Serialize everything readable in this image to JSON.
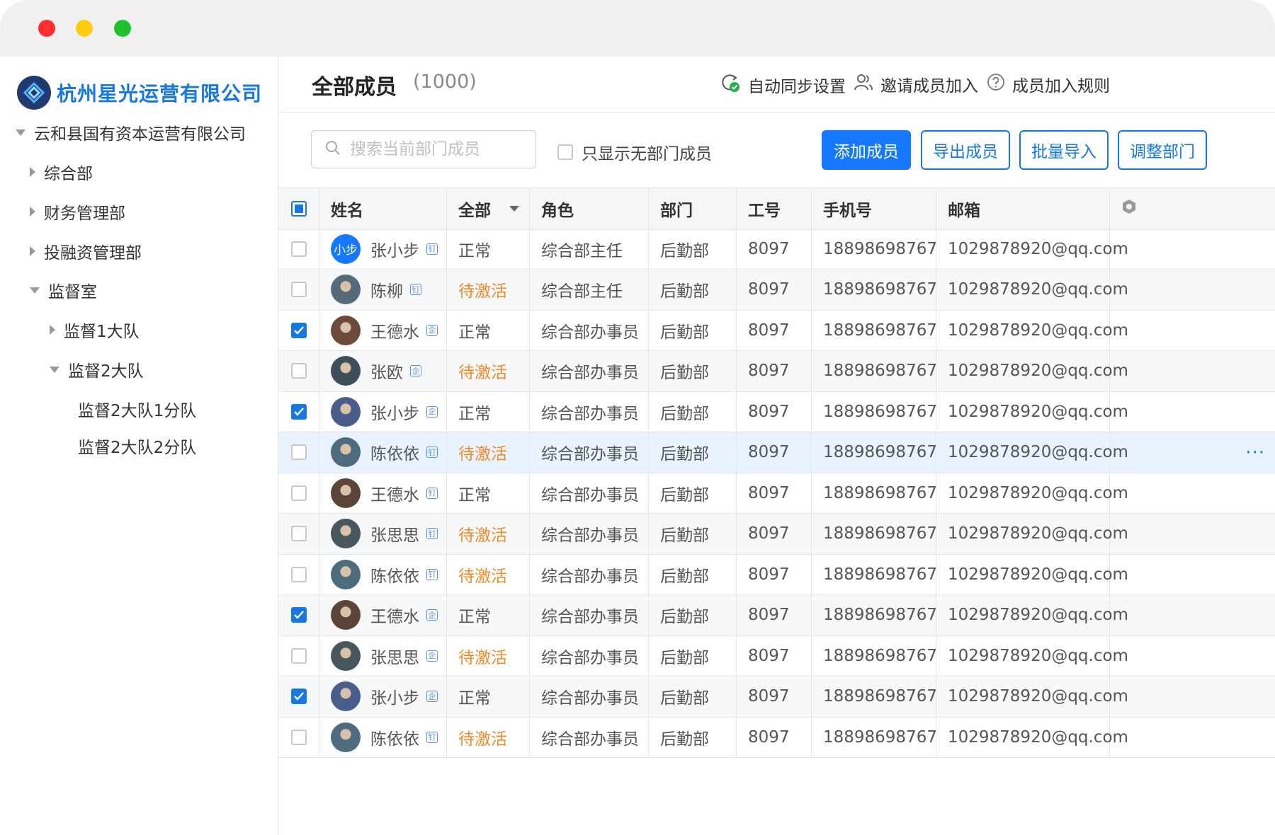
{
  "window": {
    "controls": [
      "close",
      "minimize",
      "maximize"
    ]
  },
  "sidebar": {
    "company": "杭州星光运营有限公司",
    "tree": [
      {
        "label": "云和县国有资本运营有限公司",
        "expanded": true,
        "level": 0
      },
      {
        "label": "综合部",
        "expanded": false,
        "level": 1
      },
      {
        "label": "财务管理部",
        "expanded": false,
        "level": 1
      },
      {
        "label": "投融资管理部",
        "expanded": false,
        "level": 1
      },
      {
        "label": "监督室",
        "expanded": true,
        "level": 1
      },
      {
        "label": "监督1大队",
        "expanded": false,
        "level": 2
      },
      {
        "label": "监督2大队",
        "expanded": true,
        "level": 2
      },
      {
        "label": "监督2大队1分队",
        "level": 3
      },
      {
        "label": "监督2大队2分队",
        "level": 3
      }
    ]
  },
  "header": {
    "title": "全部成员",
    "count": "(1000)",
    "actions": {
      "sync": "自动同步设置",
      "invite": "邀请成员加入",
      "rules": "成员加入规则"
    }
  },
  "toolbar": {
    "search_placeholder": "搜索当前部门成员",
    "only_no_dept": "只显示无部门成员",
    "add": "添加成员",
    "export": "导出成员",
    "import": "批量导入",
    "adjust": "调整部门"
  },
  "table": {
    "columns": {
      "name": "姓名",
      "status": "全部",
      "role": "角色",
      "dept": "部门",
      "id": "工号",
      "phone": "手机号",
      "email": "邮箱"
    },
    "rows": [
      {
        "name": "张小步",
        "avatar": "小步",
        "tag": "钉",
        "status": "正常",
        "role": "综合部主任",
        "dept": "后勤部",
        "id": "8097",
        "phone": "18898698767",
        "email": "1029878920@qq.com",
        "checked": false
      },
      {
        "name": "陈柳",
        "tag": "钉",
        "status": "待激活",
        "role": "综合部主任",
        "dept": "后勤部",
        "id": "8097",
        "phone": "18898698767",
        "email": "1029878920@qq.com",
        "checked": false
      },
      {
        "name": "王德水",
        "tag": "企",
        "status": "正常",
        "role": "综合部办事员",
        "dept": "后勤部",
        "id": "8097",
        "phone": "18898698767",
        "email": "1029878920@qq.com",
        "checked": true
      },
      {
        "name": "张欧",
        "tag": "企",
        "status": "待激活",
        "role": "综合部办事员",
        "dept": "后勤部",
        "id": "8097",
        "phone": "18898698767",
        "email": "1029878920@qq.com",
        "checked": false
      },
      {
        "name": "张小步",
        "tag": "企",
        "status": "正常",
        "role": "综合部办事员",
        "dept": "后勤部",
        "id": "8097",
        "phone": "18898698767",
        "email": "1029878920@qq.com",
        "checked": true
      },
      {
        "name": "陈依依",
        "tag": "钉",
        "status": "待激活",
        "role": "综合部办事员",
        "dept": "后勤部",
        "id": "8097",
        "phone": "18898698767",
        "email": "1029878920@qq.com",
        "checked": false,
        "more": "···"
      },
      {
        "name": "王德水",
        "tag": "钉",
        "status": "正常",
        "role": "综合部办事员",
        "dept": "后勤部",
        "id": "8097",
        "phone": "18898698767",
        "email": "1029878920@qq.com",
        "checked": false
      },
      {
        "name": "张思思",
        "tag": "钉",
        "status": "待激活",
        "role": "综合部办事员",
        "dept": "后勤部",
        "id": "8097",
        "phone": "18898698767",
        "email": "1029878920@qq.com",
        "checked": false
      },
      {
        "name": "陈依依",
        "tag": "钉",
        "status": "待激活",
        "role": "综合部办事员",
        "dept": "后勤部",
        "id": "8097",
        "phone": "18898698767",
        "email": "1029878920@qq.com",
        "checked": false
      },
      {
        "name": "王德水",
        "tag": "企",
        "status": "正常",
        "role": "综合部办事员",
        "dept": "后勤部",
        "id": "8097",
        "phone": "18898698767",
        "email": "1029878920@qq.com",
        "checked": true
      },
      {
        "name": "张思思",
        "tag": "企",
        "status": "待激活",
        "role": "综合部办事员",
        "dept": "后勤部",
        "id": "8097",
        "phone": "18898698767",
        "email": "1029878920@qq.com",
        "checked": false
      },
      {
        "name": "张小步",
        "tag": "企",
        "status": "正常",
        "role": "综合部办事员",
        "dept": "后勤部",
        "id": "8097",
        "phone": "18898698767",
        "email": "1029878920@qq.com",
        "checked": true
      },
      {
        "name": "陈依依",
        "tag": "钉",
        "status": "待激活",
        "role": "综合部办事员",
        "dept": "后勤部",
        "id": "8097",
        "phone": "18898698767",
        "email": "1029878920@qq.com",
        "checked": false
      }
    ]
  },
  "colors": {
    "primary": "#1677ff",
    "pending": "#f28b2a",
    "highlight_row": "#e8f3ff",
    "sync_check": "#21b04b"
  }
}
